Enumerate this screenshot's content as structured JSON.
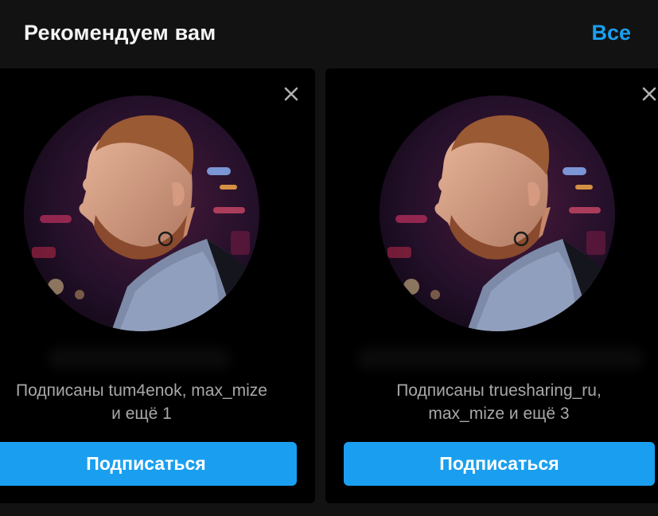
{
  "header": {
    "title": "Рекомендуем вам",
    "see_all": "Все"
  },
  "suggestions": [
    {
      "followed_by_line1": "Подписаны tum4enok, max_mize",
      "followed_by_line2": "и ещё 1",
      "follow_label": "Подписаться"
    },
    {
      "followed_by_line1": "Подписаны truesharing_ru,",
      "followed_by_line2": "max_mize и ещё 3",
      "follow_label": "Подписаться"
    }
  ],
  "colors": {
    "background": "#121212",
    "card": "#000000",
    "accent": "#1a9ff0",
    "secondary_text": "#a8a8a8"
  },
  "icons": {
    "dismiss": "close-icon"
  }
}
